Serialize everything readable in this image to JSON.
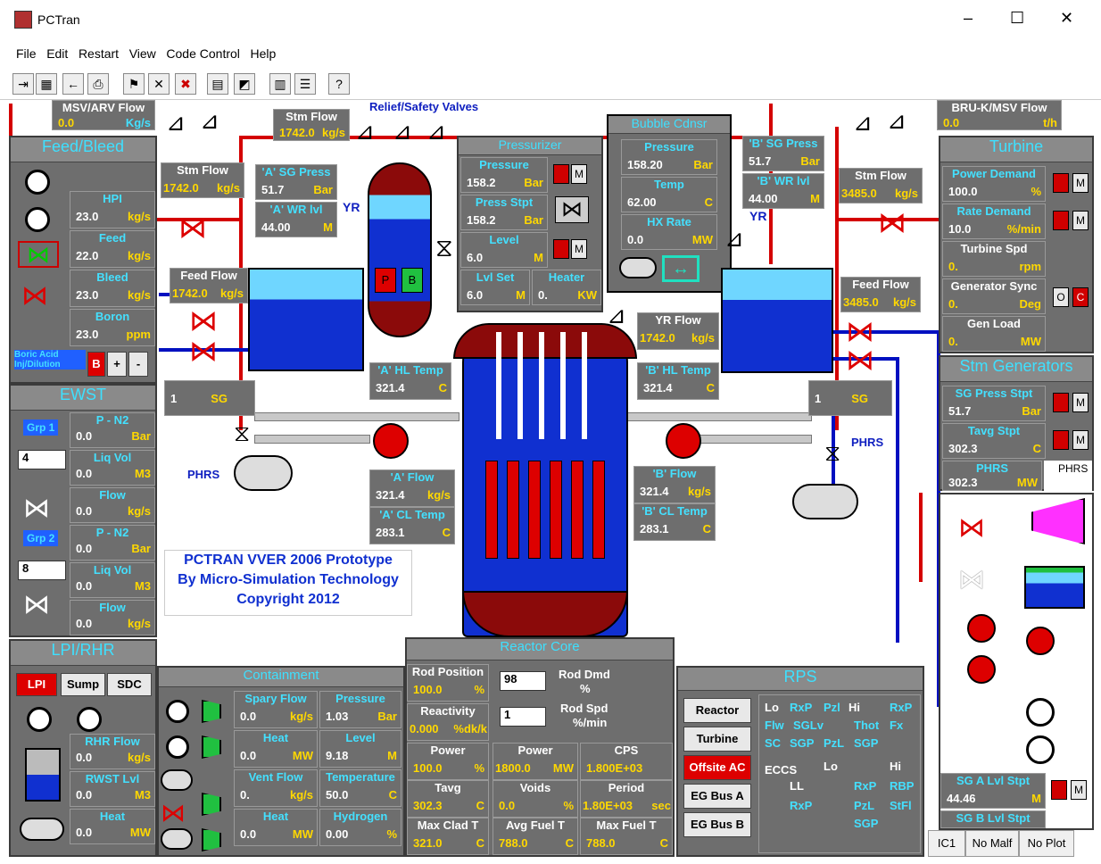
{
  "window": {
    "title": "PCTran",
    "minimize": "–",
    "maximize": "☐",
    "close": "✕"
  },
  "menu": [
    "File",
    "Edit",
    "Restart",
    "View",
    "Code Control",
    "Help"
  ],
  "toolbar_icons": [
    "exit-icon",
    "snapshot-icon",
    "back-icon",
    "print-icon",
    "run-icon",
    "stop-icon",
    "malfunction-icon",
    "plot-icon",
    "trend-icon",
    "table-icon",
    "list-icon",
    "help-icon"
  ],
  "msv_arv": {
    "label": "MSV/ARV Flow",
    "value": "0.0",
    "unit": "Kg/s"
  },
  "stm_flow_top": {
    "label": "Stm Flow",
    "value": "1742.0",
    "unit": "kg/s"
  },
  "relief_label": "Relief/Safety Valves",
  "bru": {
    "label": "BRU-K/MSV Flow",
    "value": "0.0",
    "unit": "t/h"
  },
  "feed_bleed": {
    "title": "Feed/Bleed",
    "hpi": {
      "label": "HPI",
      "value": "23.0",
      "unit": "kg/s"
    },
    "feed": {
      "label": "Feed",
      "value": "22.0",
      "unit": "kg/s"
    },
    "bleed": {
      "label": "Bleed",
      "value": "23.0",
      "unit": "kg/s"
    },
    "boron": {
      "label": "Boron",
      "value": "23.0",
      "unit": "ppm"
    },
    "boric": {
      "label": "Boric Acid",
      "sublabel": "Inj/Dilution",
      "b": "B",
      "plus": "+",
      "minus": "-"
    }
  },
  "ewst": {
    "title": "EWST",
    "p_n2_1": {
      "label": "P - N2",
      "value": "0.0",
      "unit": "Bar"
    },
    "liq_vol_1": {
      "label": "Liq Vol",
      "value": "0.0",
      "unit": "M3"
    },
    "flow_1": {
      "label": "Flow",
      "value": "0.0",
      "unit": "kg/s"
    },
    "p_n2_2": {
      "label": "P - N2",
      "value": "0.0",
      "unit": "Bar"
    },
    "liq_vol_2": {
      "label": "Liq Vol",
      "value": "0.0",
      "unit": "M3"
    },
    "flow_2": {
      "label": "Flow",
      "value": "0.0",
      "unit": "kg/s"
    },
    "grp1": "Grp 1",
    "grp2": "Grp 2",
    "spin1": "4",
    "spin2": "8"
  },
  "lpi": {
    "title": "LPI/RHR",
    "lpi": "LPI",
    "sump": "Sump",
    "sdc": "SDC",
    "rhr_flow": {
      "label": "RHR Flow",
      "value": "0.0",
      "unit": "kg/s"
    },
    "rwst_lvl": {
      "label": "RWST Lvl",
      "value": "0.0",
      "unit": "M3"
    },
    "heat": {
      "label": "Heat",
      "value": "0.0",
      "unit": "MW"
    }
  },
  "sg_a": {
    "stm_flow": {
      "label": "Stm Flow",
      "value": "1742.0",
      "unit": "kg/s"
    },
    "press": {
      "label": "'A' SG Press",
      "value": "51.7",
      "unit": "Bar"
    },
    "wr": {
      "label": "'A' WR lvl",
      "value": "44.00",
      "unit": "M"
    },
    "feed": {
      "label": "Feed Flow",
      "value": "1742.0",
      "unit": "kg/s"
    },
    "hl": {
      "label": "'A' HL Temp",
      "value": "321.4",
      "unit": "C"
    },
    "flow": {
      "label": "'A' Flow",
      "value": "321.4",
      "unit": "kg/s"
    },
    "cl": {
      "label": "'A' CL Temp",
      "value": "283.1",
      "unit": "C"
    },
    "sg": {
      "num": "1",
      "label": "SG"
    },
    "yr": "YR",
    "phrs": "PHRS"
  },
  "sg_b": {
    "stm_flow": {
      "label": "Stm Flow",
      "value": "3485.0",
      "unit": "kg/s"
    },
    "press": {
      "label": "'B' SG Press",
      "value": "51.7",
      "unit": "Bar"
    },
    "wr": {
      "label": "'B' WR lvl",
      "value": "44.00",
      "unit": "M"
    },
    "feed": {
      "label": "Feed Flow",
      "value": "3485.0",
      "unit": "kg/s"
    },
    "hl": {
      "label": "'B' HL Temp",
      "value": "321.4",
      "unit": "C"
    },
    "flow": {
      "label": "'B' Flow",
      "value": "321.4",
      "unit": "kg/s"
    },
    "cl": {
      "label": "'B' CL Temp",
      "value": "283.1",
      "unit": "C"
    },
    "yr_flow": {
      "label": "YR Flow",
      "value": "1742.0",
      "unit": "kg/s"
    },
    "sg": {
      "num": "1",
      "label": "SG"
    },
    "yr": "YR",
    "phrs": "PHRS"
  },
  "pressurizer": {
    "title": "Pressurizer",
    "pressure": {
      "label": "Pressure",
      "value": "158.2",
      "unit": "Bar"
    },
    "stpt": {
      "label": "Press Stpt",
      "value": "158.2",
      "unit": "Bar"
    },
    "level": {
      "label": "Level",
      "value": "6.0",
      "unit": "M"
    },
    "lvl_set": {
      "label": "Lvl Set",
      "value": "6.0",
      "unit": "M"
    },
    "heater": {
      "label": "Heater",
      "value": "0.",
      "unit": "KW"
    },
    "p": "P",
    "b": "B",
    "m": "M"
  },
  "bubble": {
    "title": "Bubble Cdnsr",
    "pressure": {
      "label": "Pressure",
      "value": "158.20",
      "unit": "Bar"
    },
    "temp": {
      "label": "Temp",
      "value": "62.00",
      "unit": "C"
    },
    "hx": {
      "label": "HX Rate",
      "value": "0.0",
      "unit": "MW"
    }
  },
  "turbine": {
    "title": "Turbine",
    "power_demand": {
      "label": "Power Demand",
      "value": "100.0",
      "unit": "%"
    },
    "rate_demand": {
      "label": "Rate Demand",
      "value": "10.0",
      "unit": "%/min"
    },
    "turbine_spd": {
      "label": "Turbine Spd",
      "value": "0.",
      "unit": "rpm"
    },
    "gen_sync": {
      "label": "Generator Sync",
      "value": "0.",
      "unit": "Deg"
    },
    "gen_load": {
      "label": "Gen Load",
      "value": "0.",
      "unit": "MW"
    },
    "o": "O",
    "c": "C",
    "m": "M"
  },
  "stm_gen": {
    "title": "Stm Generators",
    "sg_press_stpt": {
      "label": "SG Press Stpt",
      "value": "51.7",
      "unit": "Bar"
    },
    "tavg_stpt": {
      "label": "Tavg Stpt",
      "value": "302.3",
      "unit": "C"
    },
    "phrs": {
      "label": "PHRS",
      "value": "302.3",
      "unit": "MW"
    },
    "phrs_radio": "PHRS",
    "sg_a_lvl": {
      "label": "SG A Lvl Stpt",
      "value": "44.46",
      "unit": "M"
    },
    "sg_b_lvl": {
      "label": "SG B Lvl Stpt"
    }
  },
  "credits": {
    "line1": "PCTRAN VVER 2006 Prototype",
    "line2": "By Micro-Simulation Technology",
    "line3": "Copyright 2012"
  },
  "containment": {
    "title": "Containment",
    "spray": {
      "label": "Spary Flow",
      "value": "0.0",
      "unit": "kg/s"
    },
    "pressure": {
      "label": "Pressure",
      "value": "1.03",
      "unit": "Bar"
    },
    "heat1": {
      "label": "Heat",
      "value": "0.0",
      "unit": "MW"
    },
    "level": {
      "label": "Level",
      "value": "9.18",
      "unit": "M"
    },
    "vent": {
      "label": "Vent Flow",
      "value": "0.",
      "unit": "kg/s"
    },
    "temp": {
      "label": "Temperature",
      "value": "50.0",
      "unit": "C"
    },
    "heat2": {
      "label": "Heat",
      "value": "0.0",
      "unit": "MW"
    },
    "hydrogen": {
      "label": "Hydrogen",
      "value": "0.00",
      "unit": "%"
    }
  },
  "core": {
    "title": "Reactor Core",
    "rod_pos": {
      "label": "Rod Position",
      "value": "100.0",
      "unit": "%"
    },
    "rod_dmd": {
      "label": "Rod Dmd",
      "unit": "%",
      "value": "98"
    },
    "reactivity": {
      "label": "Reactivity",
      "value": "0.000",
      "unit": "%dk/k"
    },
    "rod_spd": {
      "label": "Rod Spd",
      "unit": "%/min",
      "value": "1"
    },
    "power1": {
      "label": "Power",
      "value": "100.0",
      "unit": "%"
    },
    "power2": {
      "label": "Power",
      "value": "1800.0",
      "unit": "MW"
    },
    "cps": {
      "label": "CPS",
      "value": "1.800E+03",
      "unit": ""
    },
    "tavg": {
      "label": "Tavg",
      "value": "302.3",
      "unit": "C"
    },
    "voids": {
      "label": "Voids",
      "value": "0.0",
      "unit": "%"
    },
    "period": {
      "label": "Period",
      "value": "1.80E+03",
      "unit": "sec"
    },
    "max_clad": {
      "label": "Max Clad T",
      "value": "321.0",
      "unit": "C"
    },
    "avg_fuel": {
      "label": "Avg Fuel T",
      "value": "788.0",
      "unit": "C"
    },
    "max_fuel": {
      "label": "Max Fuel T",
      "value": "788.0",
      "unit": "C"
    }
  },
  "rps": {
    "title": "RPS",
    "buttons": [
      "Reactor",
      "Turbine",
      "Offsite AC",
      "EG Bus A",
      "EG Bus B"
    ],
    "lo": "Lo",
    "hi": "Hi",
    "row1": [
      "RxP",
      "Pzl",
      "RxP"
    ],
    "row2": [
      "Flw",
      "SGLv",
      "Thot",
      "Fx"
    ],
    "row3": [
      "SC",
      "SGP",
      "PzL",
      "SGP"
    ],
    "eccs": "ECCS",
    "lo2": "Lo",
    "hi2": "Hi",
    "ll": "LL",
    "e1": [
      "RxP",
      "RBP"
    ],
    "e2": [
      "RxP",
      "PzL",
      "StFl"
    ],
    "e3": "SGP"
  },
  "status": [
    "IC1",
    "No Malf",
    "No Plot"
  ],
  "colors": {
    "panel": "#6e6e6e",
    "label": "#44e0ff",
    "unit": "#ffd800",
    "pipe_red": "#d40000",
    "pipe_blue": "#0010c0"
  }
}
